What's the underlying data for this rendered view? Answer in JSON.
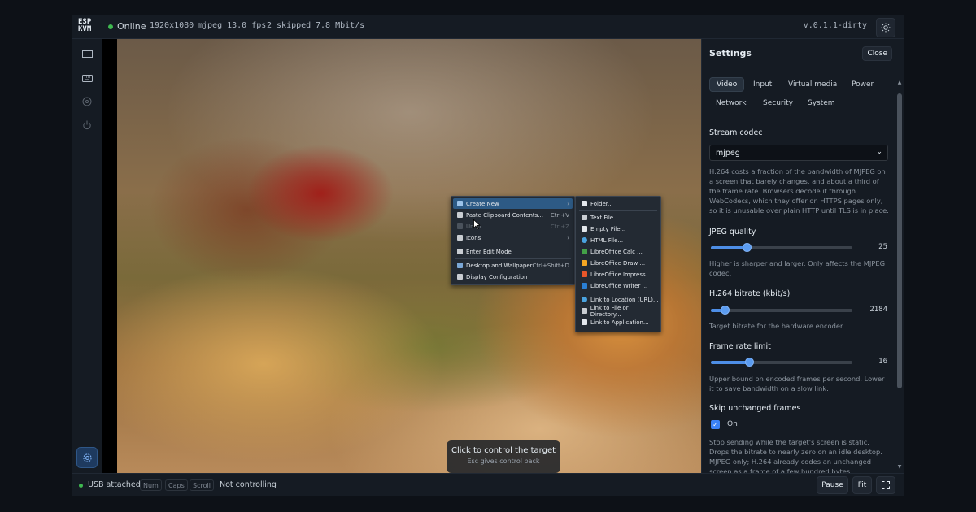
{
  "topbar": {
    "logo_line1": "ESP",
    "logo_line2": "KVM",
    "status": "Online",
    "resolution": "1920x1080",
    "codec_fps": "mjpeg 13.0 fps",
    "skipped": "2 skipped",
    "bitrate": "7.8 Mbit/s",
    "version": "v.0.1.1-dirty",
    "theme_icon": "sun-icon"
  },
  "rail": {
    "icons": [
      "monitor-icon",
      "keyboard-icon",
      "media-icon",
      "power-icon"
    ],
    "settings_icon": "gear-icon"
  },
  "context_menu": {
    "items": [
      {
        "label": "Create New",
        "shortcut": "",
        "submenu": true,
        "active": true
      },
      {
        "label": "Paste Clipboard Contents...",
        "shortcut": "Ctrl+V"
      },
      {
        "label": "Undo",
        "shortcut": "Ctrl+Z",
        "disabled": true
      },
      {
        "label": "Icons",
        "shortcut": "",
        "submenu": true
      },
      {
        "label": "Enter Edit Mode",
        "shortcut": ""
      },
      {
        "label": "Desktop and Wallpaper",
        "shortcut": "Ctrl+Shift+D"
      },
      {
        "label": "Display Configuration",
        "shortcut": ""
      }
    ],
    "submenu_items": [
      "Folder...",
      "Text File...",
      "Empty File...",
      "HTML File...",
      "LibreOffice Calc ...",
      "LibreOffice Draw ...",
      "LibreOffice Impress ...",
      "LibreOffice Writer ...",
      "Link to Location (URL)...",
      "Link to File or Directory...",
      "Link to Application..."
    ]
  },
  "hint": {
    "title": "Click to control the target",
    "subtitle": "Esc gives control back"
  },
  "settings": {
    "title": "Settings",
    "close_label": "Close",
    "tabs": [
      "Video",
      "Input",
      "Virtual media",
      "Power",
      "Network",
      "Security",
      "System"
    ],
    "active_tab": "Video",
    "stream_codec": {
      "label": "Stream codec",
      "value": "mjpeg",
      "description": "H.264 costs a fraction of the bandwidth of MJPEG on a screen that barely changes, and about a third of the frame rate. Browsers decode it through WebCodecs, which they offer on HTTPS pages only, so it is unusable over plain HTTP until TLS is in place."
    },
    "jpeg_quality": {
      "label": "JPEG quality",
      "value": "25",
      "fraction": 0.25,
      "description": "Higher is sharper and larger. Only affects the MJPEG codec."
    },
    "h264_bitrate": {
      "label": "H.264 bitrate (kbit/s)",
      "value": "2184",
      "fraction": 0.1,
      "description": "Target bitrate for the hardware encoder."
    },
    "frame_rate": {
      "label": "Frame rate limit",
      "value": "16",
      "fraction": 0.27,
      "description": "Upper bound on encoded frames per second. Lower it to save bandwidth on a slow link."
    },
    "skip_unchanged": {
      "label": "Skip unchanged frames",
      "checkbox_label": "On",
      "checked": true,
      "description": "Stop sending while the target's screen is static. Drops the bitrate to nearly zero on an idle desktop. MJPEG only; H.264 already codes an unchanged screen as a frame of a few hundred bytes."
    }
  },
  "bottombar": {
    "usb_status": "USB attached",
    "keys": [
      "Num",
      "Caps",
      "Scroll"
    ],
    "control_status": "Not controlling",
    "pause_label": "Pause",
    "fit_label": "Fit",
    "fullscreen_icon": "fullscreen-icon"
  },
  "colors": {
    "accent": "#3b82f6",
    "online": "#3fb950",
    "background": "#151b23"
  }
}
